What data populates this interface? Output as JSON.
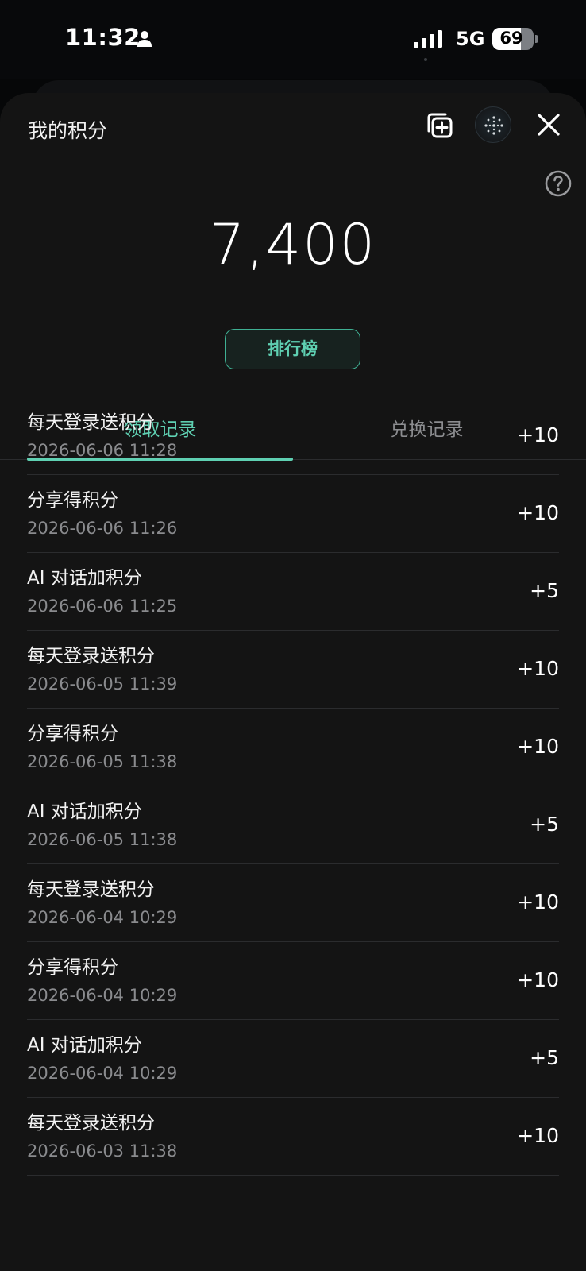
{
  "status_bar": {
    "time": "11:32",
    "network": "5G",
    "battery_level": 69,
    "battery_text": "69"
  },
  "header": {
    "title": "我的积分"
  },
  "points": {
    "total": "7,400"
  },
  "leaderboard_label": "排行榜",
  "tabs": [
    {
      "label": "领取记录",
      "active": true
    },
    {
      "label": "兑换记录",
      "active": false
    }
  ],
  "records": [
    {
      "title": "每天登录送积分",
      "time": "2026-06-06 11:28",
      "points": "+10"
    },
    {
      "title": "分享得积分",
      "time": "2026-06-06 11:26",
      "points": "+10"
    },
    {
      "title": "AI 对话加积分",
      "time": "2026-06-06 11:25",
      "points": "+5"
    },
    {
      "title": "每天登录送积分",
      "time": "2026-06-05 11:39",
      "points": "+10"
    },
    {
      "title": "分享得积分",
      "time": "2026-06-05 11:38",
      "points": "+10"
    },
    {
      "title": "AI 对话加积分",
      "time": "2026-06-05 11:38",
      "points": "+5"
    },
    {
      "title": "每天登录送积分",
      "time": "2026-06-04 10:29",
      "points": "+10"
    },
    {
      "title": "分享得积分",
      "time": "2026-06-04 10:29",
      "points": "+10"
    },
    {
      "title": "AI 对话加积分",
      "time": "2026-06-04 10:29",
      "points": "+5"
    },
    {
      "title": "每天登录送积分",
      "time": "2026-06-03 11:38",
      "points": "+10"
    }
  ],
  "colors": {
    "accent": "#5fd0b2",
    "background": "#141414",
    "muted_text": "#8a8b8e"
  },
  "icons": [
    "person-icon",
    "signal-icon",
    "battery-icon",
    "copy-add-icon",
    "avatar-icon",
    "close-icon",
    "help-icon"
  ]
}
